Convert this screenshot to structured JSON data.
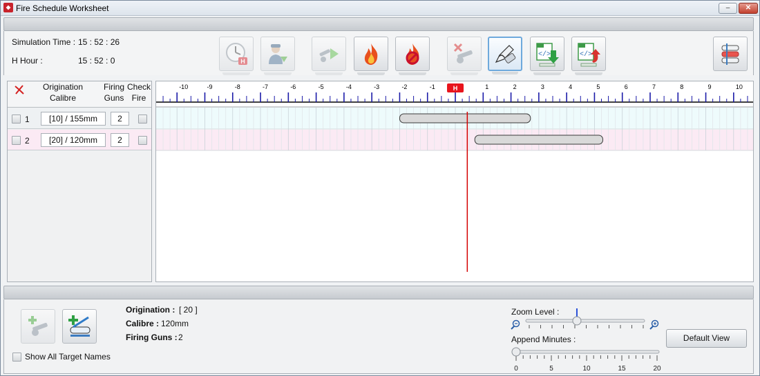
{
  "window": {
    "title": "Fire Schedule Worksheet",
    "minimize": "–",
    "close": "✕"
  },
  "info": {
    "simulation_time_label": "Simulation Time :",
    "simulation_time_value": "15 : 52 : 26",
    "h_hour_label": "H Hour :",
    "h_hour_value": "15 : 52 : 0"
  },
  "toolbar": [
    {
      "name": "h-hour-clock-button",
      "icon": "clock-h-icon",
      "state": "disabled"
    },
    {
      "name": "assign-soldier-button",
      "icon": "soldier-icon",
      "state": "disabled"
    },
    {
      "name": "play-fire-button",
      "icon": "cannon-play-icon",
      "state": "disabled"
    },
    {
      "name": "fire-button",
      "icon": "fire-icon",
      "state": "normal"
    },
    {
      "name": "cease-fire-button",
      "icon": "fire-stop-icon",
      "state": "normal"
    },
    {
      "name": "remove-gun-button",
      "icon": "cannon-delete-icon",
      "state": "disabled"
    },
    {
      "name": "edit-erase-button",
      "icon": "pen-eraser-icon",
      "state": "active"
    },
    {
      "name": "import-xml-button",
      "icon": "xml-import-icon",
      "state": "normal"
    },
    {
      "name": "export-xml-button",
      "icon": "xml-export-icon",
      "state": "normal"
    },
    {
      "name": "layout-toggle-button",
      "icon": "layers-icon",
      "state": "normal"
    }
  ],
  "list_header": {
    "delete_icon": "red-x-icon",
    "origination": "Origination",
    "calibre": "Calibre",
    "firing": "Firing",
    "guns": "Guns",
    "check": "Check",
    "fire": "Fire"
  },
  "rows": [
    {
      "index": "1",
      "origination_calibre": "[10] / 155mm",
      "firing_guns": "2",
      "start_min": -2,
      "end_min": 2.7
    },
    {
      "index": "2",
      "origination_calibre": "[20] / 120mm",
      "firing_guns": "2",
      "start_min": 0.7,
      "end_min": 5.3
    }
  ],
  "timeline": {
    "min": -10.7,
    "max": 10.6,
    "major_labels": [
      "-10",
      "-9",
      "-8",
      "-7",
      "-6",
      "-5",
      "-4",
      "-3",
      "-2",
      "-1",
      "1",
      "2",
      "3",
      "4",
      "5",
      "6",
      "7",
      "8",
      "9",
      "10"
    ],
    "h_marker": "H",
    "current_time_min": 0.43
  },
  "details": {
    "origination_label": "Origination :",
    "origination_value": "[ 20 ]",
    "calibre_label": "Calibre :",
    "calibre_value": "120mm",
    "firing_guns_label": "Firing Guns :",
    "firing_guns_value": "2"
  },
  "show_all_targets_label": "Show All Target Names",
  "zoom": {
    "label": "Zoom Level :",
    "value_fraction": 0.43
  },
  "append": {
    "label": "Append Minutes :",
    "value": 0,
    "ticks": [
      "0",
      "5",
      "10",
      "15",
      "20"
    ]
  },
  "default_view_label": "Default View"
}
